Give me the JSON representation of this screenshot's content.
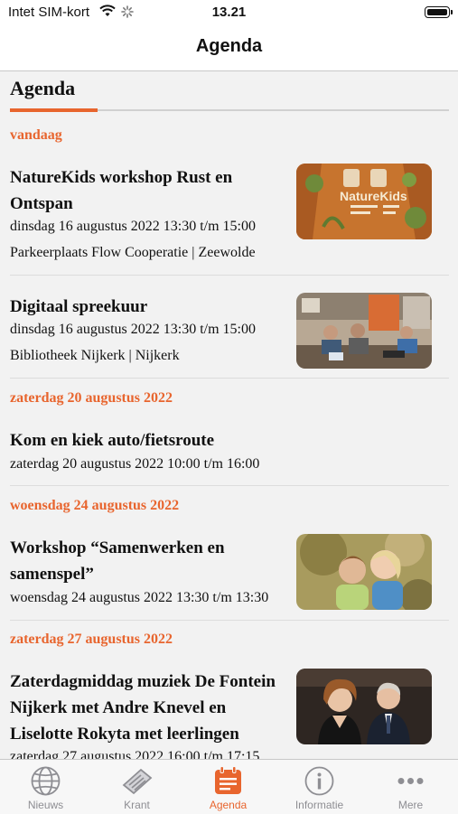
{
  "status": {
    "carrier": "Intet SIM-kort",
    "time": "13.21"
  },
  "nav": {
    "title": "Agenda"
  },
  "section": {
    "heading": "Agenda"
  },
  "groups": {
    "today": "vandaag",
    "sat20": "zaterdag 20 augustus 2022",
    "wed24": "woensdag 24 augustus 2022",
    "sat27": "zaterdag 27 augustus 2022"
  },
  "events": [
    {
      "title_1": "NatureKids workshop Rust en",
      "title_2": "Ontspan",
      "when": "dinsdag 16 augustus 2022 13:30 t/m 15:00",
      "where": "Parkeerplaats Flow Cooperatie | Zeewolde",
      "thumb_text": "NatureKids"
    },
    {
      "title_1": "Digitaal spreekuur",
      "when": "dinsdag 16 augustus 2022 13:30 t/m 15:00",
      "where": "Bibliotheek Nijkerk | Nijkerk"
    },
    {
      "title_1": "Kom en kiek auto/fietsroute",
      "when": "zaterdag 20 augustus 2022 10:00 t/m 16:00"
    },
    {
      "title_1": "Workshop “Samenwerken en",
      "title_2": "samenspel”",
      "when": "woensdag 24 augustus 2022 13:30 t/m 13:30"
    },
    {
      "title_1": "Zaterdagmiddag muziek De Fontein",
      "title_2": "Nijkerk met Andre Knevel en",
      "title_3": "Liselotte Rokyta met leerlingen",
      "when": "zaterdag 27 augustus 2022 16:00 t/m 17:15"
    }
  ],
  "tabs": [
    {
      "label": "Nieuws",
      "icon": "globe-icon"
    },
    {
      "label": "Krant",
      "icon": "newspaper-icon"
    },
    {
      "label": "Agenda",
      "icon": "calendar-icon",
      "active": true
    },
    {
      "label": "Informatie",
      "icon": "info-icon"
    },
    {
      "label": "Mere",
      "icon": "more-icon"
    }
  ],
  "colors": {
    "accent": "#e8652e",
    "inactive": "#8e8e93"
  }
}
